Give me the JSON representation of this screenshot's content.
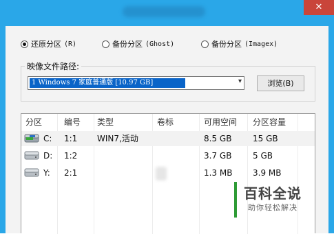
{
  "window": {
    "close_label": "✕"
  },
  "restore_options": [
    {
      "label": "还原分区",
      "hotkey": "(R)",
      "selected": true
    },
    {
      "label": "备份分区",
      "hotkey": "(Ghost)",
      "selected": false
    },
    {
      "label": "备份分区",
      "hotkey": "(Imagex)",
      "selected": false
    }
  ],
  "image_path": {
    "label": "映像文件路径:",
    "selected_value": "1 Windows 7 家庭普通版 [10.97 GB]",
    "browse_label": "浏览(B)"
  },
  "partition_table": {
    "columns": [
      "分区",
      "编号",
      "类型",
      "卷标",
      "可用空间",
      "分区容量"
    ],
    "rows": [
      {
        "drive": "C:",
        "number": "1:1",
        "type": "WIN7,活动",
        "label": "",
        "free": "8.5 GB",
        "capacity": "15 GB",
        "icon": "system-disk-icon"
      },
      {
        "drive": "D:",
        "number": "1:2",
        "type": "",
        "label": "",
        "free": "3.7 GB",
        "capacity": "5 GB",
        "icon": "disk-icon"
      },
      {
        "drive": "Y:",
        "number": "2:1",
        "type": "",
        "label": "",
        "free": "1.3 MB",
        "capacity": "3.9 MB",
        "icon": "disk-icon"
      }
    ]
  },
  "watermark": {
    "title": "百科全说",
    "subtitle": "助你轻松解决"
  },
  "colors": {
    "title_bar": "#2aa7e8",
    "selection": "#0a64c8",
    "close_button": "#c9453a",
    "watermark_accent": "#2e9b35"
  }
}
